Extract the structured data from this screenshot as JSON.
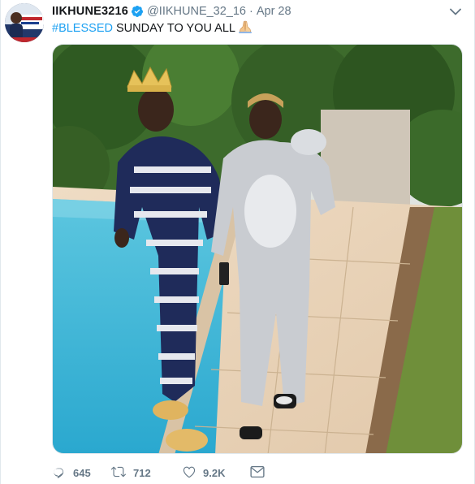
{
  "author": {
    "name": "IIKHUNE3216",
    "handle": "@IIKHUNE_32_16",
    "separator": "·",
    "date": "Apr 28",
    "verified": true
  },
  "tweet": {
    "hashtag": "#BLESSED",
    "text": " SUNDAY TO YOU ALL",
    "emoji": "praying-hands-emoji"
  },
  "media": {
    "type": "photo",
    "alt_icon": "photo"
  },
  "actions": {
    "replies": "645",
    "retweets": "712",
    "likes": "9.2K"
  },
  "colors": {
    "accent": "#1da1f2",
    "muted": "#657786",
    "text": "#14171a",
    "border": "#e1e8ed"
  },
  "icons": {
    "verified": "verified-badge-icon",
    "caret": "chevron-down-icon",
    "reply": "reply-icon",
    "retweet": "retweet-icon",
    "like": "heart-icon",
    "dm": "envelope-icon"
  }
}
